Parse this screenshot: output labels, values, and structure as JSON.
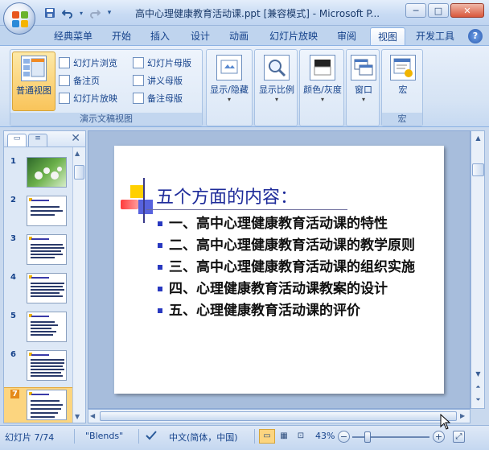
{
  "window": {
    "title": "高中心理健康教育活动课.ppt [兼容模式] - Microsoft P...",
    "minimize": "─",
    "maximize": "□",
    "close": "✕"
  },
  "qat": {
    "save_icon": "save-icon",
    "undo_icon": "undo-icon",
    "redo_icon": "redo-icon",
    "customize_icon": "dropdown-icon"
  },
  "tabs": [
    {
      "label": "经典菜单"
    },
    {
      "label": "开始"
    },
    {
      "label": "插入"
    },
    {
      "label": "设计"
    },
    {
      "label": "动画"
    },
    {
      "label": "幻灯片放映"
    },
    {
      "label": "审阅"
    },
    {
      "label": "视图",
      "active": true
    },
    {
      "label": "开发工具"
    }
  ],
  "help": "?",
  "ribbon": {
    "presentation_views": {
      "label": "演示文稿视图",
      "normal": "普通视图",
      "slide_sorter": "幻灯片浏览",
      "notes_page": "备注页",
      "slide_show": "幻灯片放映",
      "slide_master": "幻灯片母版",
      "handout_master": "讲义母版",
      "notes_master": "备注母版"
    },
    "show_hide": "显示/隐藏",
    "zoom": "显示比例",
    "color_gray": "颜色/灰度",
    "window": "窗口",
    "macros": {
      "label": "宏",
      "button": "宏"
    }
  },
  "thumbnails": [
    {
      "num": "1"
    },
    {
      "num": "2"
    },
    {
      "num": "3"
    },
    {
      "num": "4"
    },
    {
      "num": "5"
    },
    {
      "num": "6"
    },
    {
      "num": "7",
      "selected": true
    }
  ],
  "slide": {
    "title": "五个方面的内容：",
    "bullets": [
      "一、高中心理健康教育活动课的特性",
      "二、高中心理健康教育活动课的教学原则",
      "三、高中心理健康教育活动课的组织实施",
      "四、心理健康教育活动课教案的设计",
      "五、心理健康教育活动课的评价"
    ]
  },
  "status": {
    "slide_info": "幻灯片 7/74",
    "theme": "\"Blends\"",
    "language": "中文(简体，中国)",
    "zoom": "43%",
    "zoom_level_percent": 43
  },
  "colors": {
    "accent": "#15428b",
    "title_text": "#1e2b9a",
    "bullet": "#2838c0",
    "selected": "#fcd57f"
  }
}
